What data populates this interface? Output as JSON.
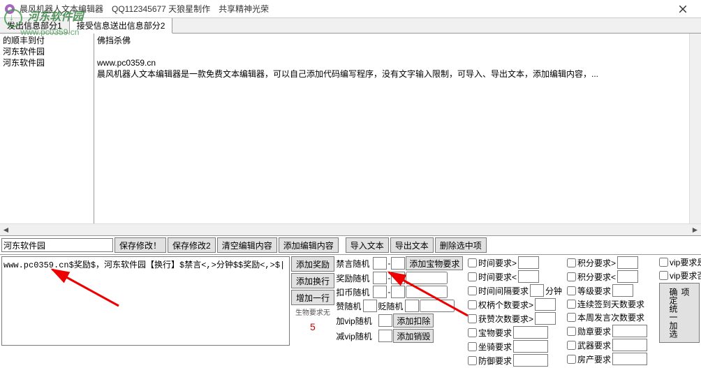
{
  "window": {
    "title": "晨风机器人文本编辑器　QQ112345677 天狼星制作　共享精神光荣"
  },
  "tabs": {
    "left_tab": "发出信息部分1",
    "right_tab": "接受信息送出信息部分2"
  },
  "left_col": {
    "line1": "的顺丰到付",
    "line2": "河东软件园",
    "line3": "河东软件园"
  },
  "right_col": {
    "line0": "佛挡杀佛",
    "line1": "www.pc0359.cn",
    "line2": "晨风机器人文本编辑器是一款免费文本编辑器，可以自己添加代码编写程序，没有文字输入限制，可导入、导出文本，添加编辑内容，..."
  },
  "mid_row": {
    "input_val": "河东软件园",
    "save1": "保存修改！",
    "save2": "保存修改2",
    "clear": "清空编辑内容",
    "add_edit": "添加编辑内容",
    "import": "导入文本",
    "export": "导出文本",
    "del_sel": "删除选中项"
  },
  "editor": {
    "content": "www.pc0359.cn$奖励$，河东软件园【换行】$禁言<,>分钟$$奖励<,>$|"
  },
  "mid_btns": {
    "add_reward": "添加奖励",
    "add_newline": "添加换行",
    "add_line": "增加一行",
    "bio_req": "生物要求无",
    "num": "5"
  },
  "center_rows": {
    "ban": "禁言随机",
    "reward": "奖励随机",
    "coin": "扣币随机",
    "zan": "赞随机",
    "jian": "贬随机",
    "addvip": "加vip随机",
    "subvip": "减vip随机",
    "add_treasure": "添加宝物要求",
    "add_deduct": "添加扣除",
    "add_destroy": "添加销毁"
  },
  "req_col1": {
    "time_gt": "时间要求>",
    "time_lt": "时间要求<",
    "time_gap": "时间间隔要求",
    "minutes": "分钟",
    "power_gt": "权柄个数要求>",
    "praise_gt": "获赞次数要求>",
    "treasure": "宝物要求",
    "mount": "坐骑要求",
    "defense": "防御要求"
  },
  "req_col2": {
    "score_gt": "积分要求>",
    "score_lt": "积分要求<",
    "level": "等级要求",
    "streak": "连续签到天数要求",
    "week_speak": "本周发言次数要求",
    "medal": "勋章要求",
    "weapon": "武器要求",
    "house": "房产要求"
  },
  "req_col3": {
    "vip_yes": "vip要求是",
    "vip_no": "vip要求否",
    "extra_opts": "确定统一加选项"
  },
  "watermark": {
    "name": "河东软件园",
    "url": "www.pc0359.cn"
  }
}
